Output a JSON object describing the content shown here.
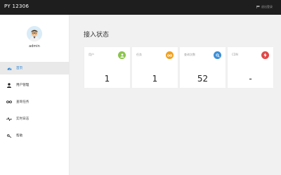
{
  "app": {
    "title": "PY 12306"
  },
  "topbar": {
    "action_label": "退出登录"
  },
  "user": {
    "name": "admin"
  },
  "sidebar": {
    "items": [
      {
        "label": "首页",
        "icon": "dashboard-icon",
        "active": true
      },
      {
        "label": "用户管理",
        "icon": "user-icon",
        "active": false
      },
      {
        "label": "查询任务",
        "icon": "infinity-icon",
        "active": false
      },
      {
        "label": "实时日志",
        "icon": "activity-icon",
        "active": false
      },
      {
        "label": "帮助",
        "icon": "key-icon",
        "active": false
      }
    ]
  },
  "main": {
    "title": "接入状态",
    "cards": [
      {
        "label": "用户",
        "value": "1",
        "icon": "user-icon",
        "color": "#8cc44e"
      },
      {
        "label": "任务",
        "value": "1",
        "icon": "infinity-icon",
        "color": "#f0a01e"
      },
      {
        "label": "查询次数",
        "value": "52",
        "icon": "search-icon",
        "color": "#3d8fd6"
      },
      {
        "label": "CDN",
        "value": "-",
        "icon": "bolt-icon",
        "color": "#e04848"
      }
    ]
  }
}
